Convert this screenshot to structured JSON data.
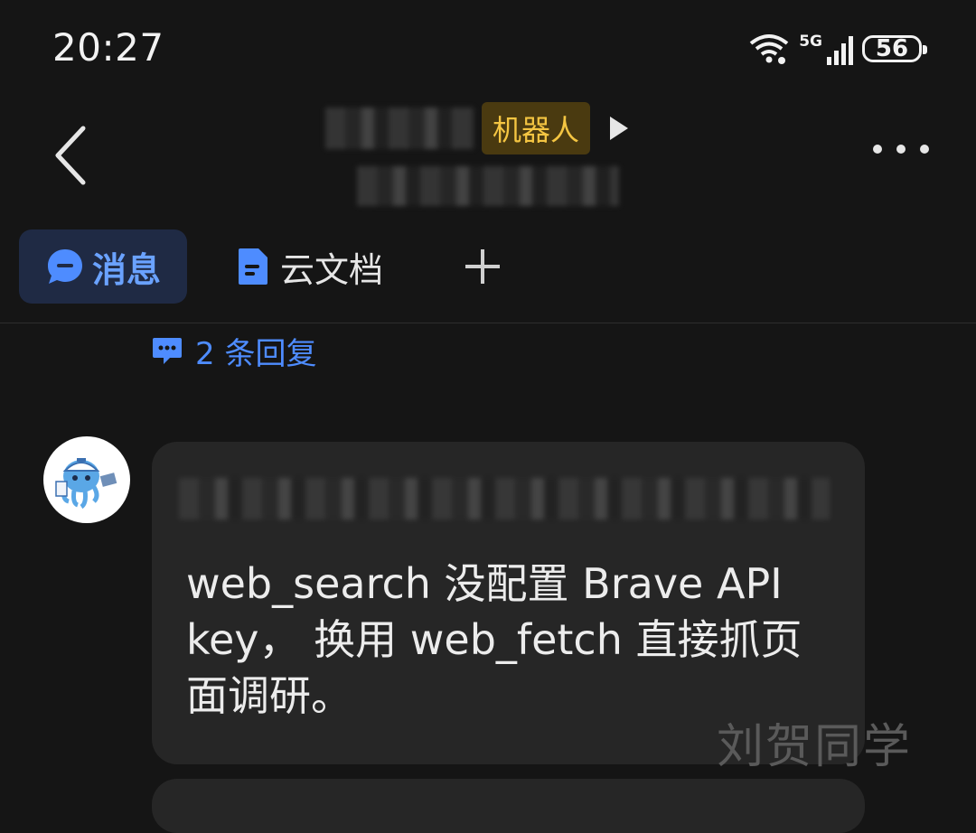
{
  "status_bar": {
    "time": "20:27",
    "network_label": "5G",
    "battery": "56",
    "icons": [
      "wifi-icon",
      "signal-icon",
      "battery-icon"
    ]
  },
  "header": {
    "title": "",
    "bot_badge": "机器人",
    "icons": [
      "back-icon",
      "play-icon",
      "more-icon"
    ]
  },
  "tabs": {
    "messages": "消息",
    "docs": "云文档",
    "add": "+"
  },
  "thread": {
    "replies": "2 条回复"
  },
  "message": {
    "text": "web_search 没配置 Brave API key， 换用 web_fetch 直接抓页面调研。"
  },
  "watermark": "刘贺同学",
  "colors": {
    "background": "#151515",
    "accent_blue": "#4e8cff",
    "badge_gold": "#f4c542",
    "bubble": "#262626"
  }
}
